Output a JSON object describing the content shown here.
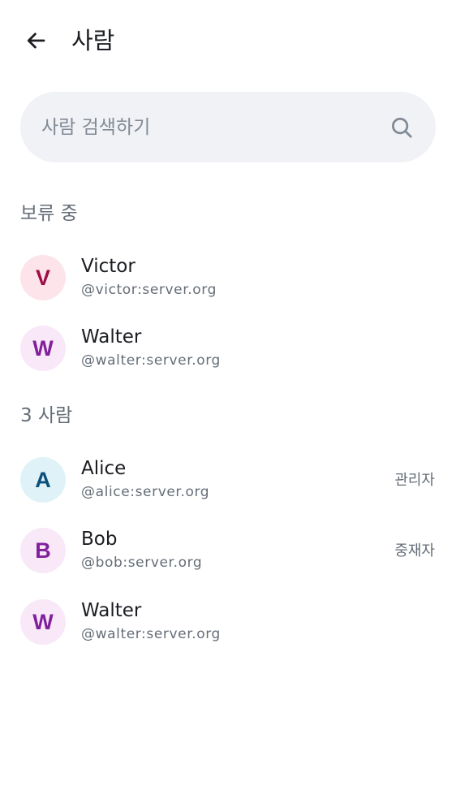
{
  "header": {
    "title": "사람",
    "back_icon": "arrow-left-icon"
  },
  "search": {
    "placeholder": "사람 검색하기",
    "value": "",
    "icon": "search-icon"
  },
  "pending": {
    "title": "보류 중",
    "members": [
      {
        "initial": "V",
        "name": "Victor",
        "user_id": "@victor:server.org",
        "avatar_bg": "#fde4ea",
        "avatar_fg": "#9b0d45"
      },
      {
        "initial": "W",
        "name": "Walter",
        "user_id": "@walter:server.org",
        "avatar_bg": "#f8e8f8",
        "avatar_fg": "#82209c"
      }
    ]
  },
  "joined": {
    "title": "3 사람",
    "members": [
      {
        "initial": "A",
        "name": "Alice",
        "user_id": "@alice:server.org",
        "role": "관리자",
        "avatar_bg": "#dff2f7",
        "avatar_fg": "#0b4f7a"
      },
      {
        "initial": "B",
        "name": "Bob",
        "user_id": "@bob:server.org",
        "role": "중재자",
        "avatar_bg": "#f8e8f8",
        "avatar_fg": "#82209c"
      },
      {
        "initial": "W",
        "name": "Walter",
        "user_id": "@walter:server.org",
        "avatar_bg": "#f8e8f8",
        "avatar_fg": "#82209c"
      }
    ]
  }
}
